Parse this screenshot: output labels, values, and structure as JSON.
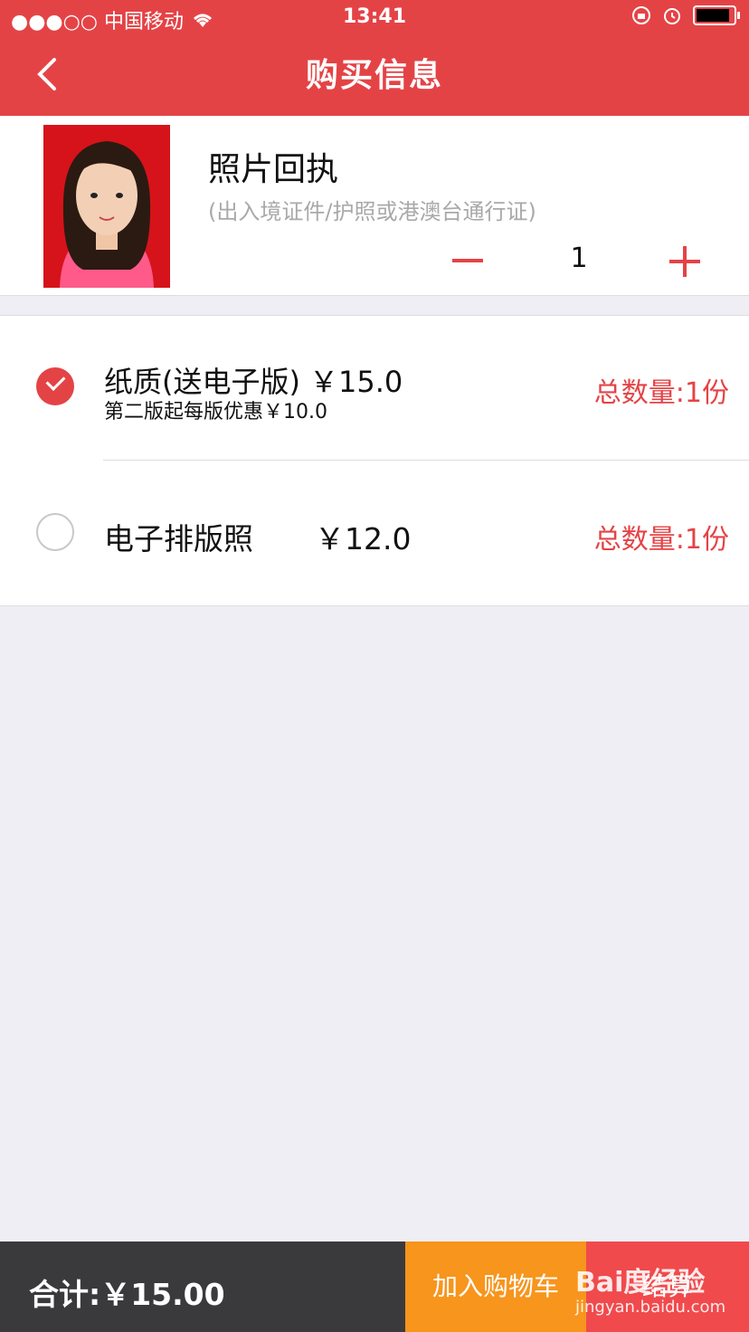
{
  "status_bar": {
    "carrier": "●●●○○ 中国移动",
    "time": "13:41"
  },
  "header": {
    "title": "购买信息"
  },
  "product": {
    "name": "照片回执",
    "description": "(出入境证件/护照或港澳台通行证)",
    "quantity": "1"
  },
  "options": [
    {
      "name": "纸质(送电子版)",
      "price": "￥15.0",
      "subtitle": "第二版起每版优惠￥10.0",
      "total": "总数量:1份",
      "selected": true
    },
    {
      "name": "电子排版照",
      "price": "￥12.0",
      "total": "总数量:1份",
      "selected": false
    }
  ],
  "footer": {
    "sum": "合计:￥15.00",
    "cart_button": "加入购物车",
    "checkout_button": "结算"
  },
  "watermark": {
    "brand": "Bai度经验",
    "url": "jingyan.baidu.com"
  },
  "colors": {
    "accent": "#e44346",
    "cart": "#f7951d",
    "footer_dark": "#3a3a3c"
  }
}
